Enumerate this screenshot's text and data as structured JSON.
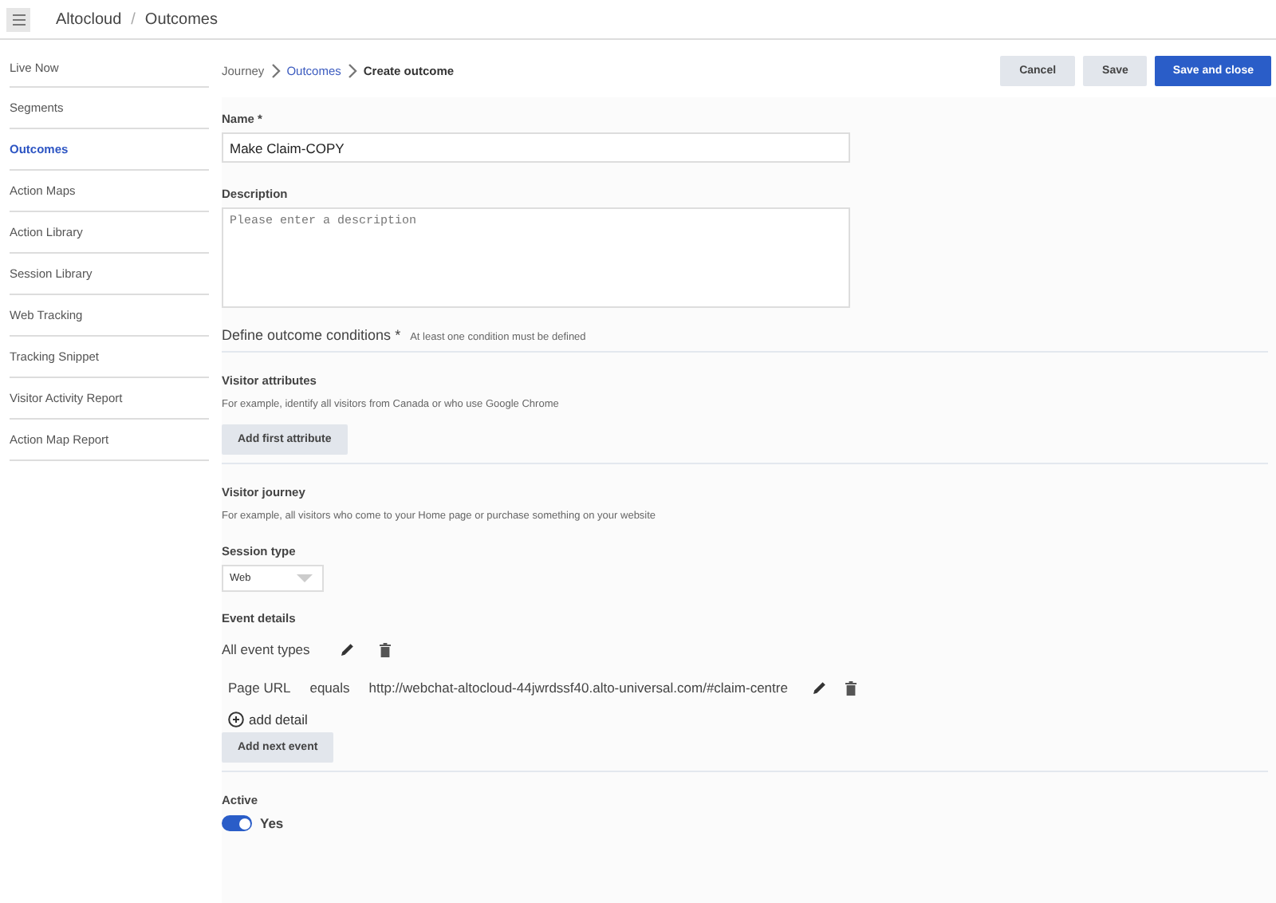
{
  "header": {
    "app": "Altocloud",
    "separator": "/",
    "page": "Outcomes"
  },
  "sidebar": {
    "items": [
      {
        "label": "Live Now",
        "selected": false
      },
      {
        "label": "Segments",
        "selected": false
      },
      {
        "label": "Outcomes",
        "selected": true
      },
      {
        "label": "Action Maps",
        "selected": false
      },
      {
        "label": "Action Library",
        "selected": false
      },
      {
        "label": "Session Library",
        "selected": false
      },
      {
        "label": "Web Tracking",
        "selected": false
      },
      {
        "label": "Tracking Snippet",
        "selected": false
      },
      {
        "label": "Visitor Activity Report",
        "selected": false
      },
      {
        "label": "Action Map Report",
        "selected": false
      }
    ]
  },
  "breadcrumb": [
    {
      "label": "Journey",
      "kind": "link"
    },
    {
      "label": "Outcomes",
      "kind": "active-link"
    },
    {
      "label": "Create outcome",
      "kind": "current"
    }
  ],
  "buttons": [
    {
      "label": "Cancel",
      "kind": "secondary"
    },
    {
      "label": "Save",
      "kind": "secondary"
    },
    {
      "label": "Save and close",
      "kind": "primary"
    }
  ],
  "form": {
    "name": {
      "label": "Name *",
      "value": "Make Claim-COPY"
    },
    "description": {
      "label": "Description",
      "placeholder": "Please enter a description"
    },
    "conditions": {
      "title": "Define outcome conditions *",
      "note": "At least one condition must be defined"
    },
    "visitor_attributes": {
      "title": "Visitor attributes",
      "hint": "For example, identify all visitors from Canada or who use Google Chrome",
      "button": "Add first attribute"
    },
    "visitor_journey": {
      "title": "Visitor journey",
      "hint": "For example, all visitors who come to your Home page or purchase something on your website"
    },
    "session_type": {
      "label": "Session type",
      "value": "Web"
    },
    "event_details": {
      "label": "Event details",
      "event_type": "All event types",
      "detail": {
        "attribute": "Page URL",
        "operator": "equals",
        "value": "http://webchat-altocloud-44jwrdssf40.alto-universal.com/#claim-centre"
      },
      "add_detail": "add detail",
      "add_event": "Add next event"
    },
    "active": {
      "label": "Active",
      "on": true,
      "text": "Yes"
    }
  }
}
